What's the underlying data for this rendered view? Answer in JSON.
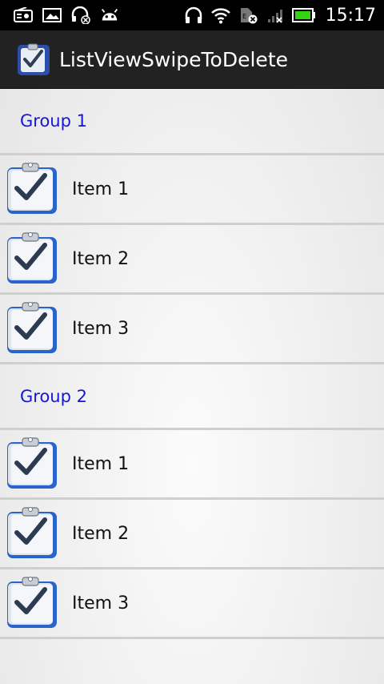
{
  "status_bar": {
    "icons_left": [
      "radio-icon",
      "image-icon",
      "headset-mute-icon",
      "android-icon"
    ],
    "icons_right": [
      "headphones-icon",
      "wifi-icon",
      "no-sim-icon",
      "signal-icon",
      "battery-icon"
    ],
    "time": "15:17"
  },
  "action_bar": {
    "title": "ListViewSwipeToDelete",
    "icon": "clipboard-check-icon"
  },
  "groups": [
    {
      "title": "Group 1",
      "items": [
        {
          "label": "Item 1",
          "icon": "clipboard-check-icon"
        },
        {
          "label": "Item 2",
          "icon": "clipboard-check-icon"
        },
        {
          "label": "Item 3",
          "icon": "clipboard-check-icon"
        }
      ]
    },
    {
      "title": "Group 2",
      "items": [
        {
          "label": "Item 1",
          "icon": "clipboard-check-icon"
        },
        {
          "label": "Item 2",
          "icon": "clipboard-check-icon"
        },
        {
          "label": "Item 3",
          "icon": "clipboard-check-icon"
        }
      ]
    }
  ],
  "colors": {
    "group_title": "#1616d6",
    "divider": "#cfcfcf",
    "action_bar": "#222222",
    "status_bar": "#000000"
  }
}
